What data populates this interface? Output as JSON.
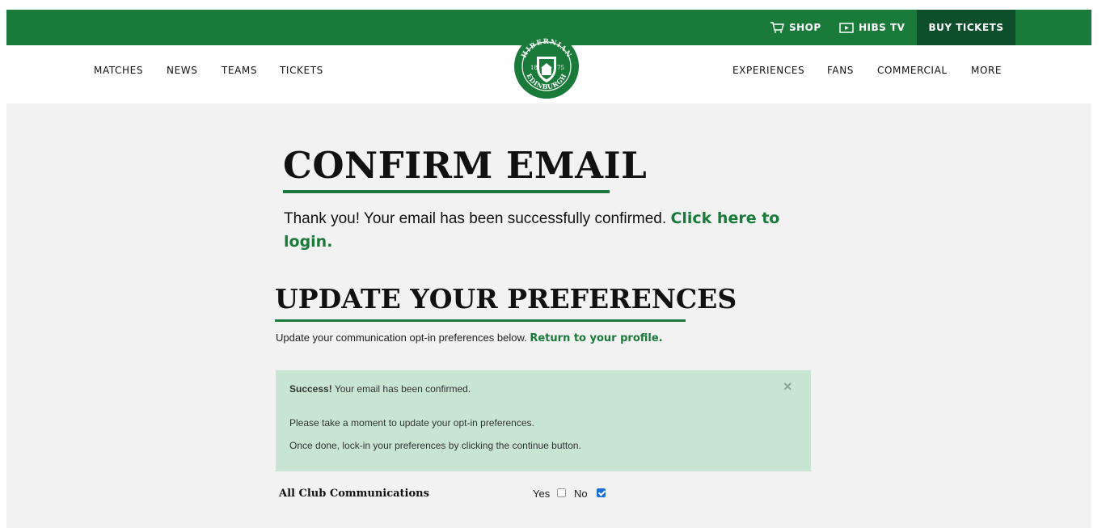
{
  "topbar": {
    "shop_label": "SHOP",
    "tv_label": "HIBS TV",
    "buy_label": "BUY TICKETS"
  },
  "nav": {
    "left": [
      "MATCHES",
      "NEWS",
      "TEAMS",
      "TICKETS"
    ],
    "right": [
      "EXPERIENCES",
      "FANS",
      "COMMERCIAL",
      "MORE"
    ]
  },
  "logo": {
    "top_text": "HIBERNIAN",
    "bottom_text": "EDINBURGH",
    "year_left": "18",
    "year_right": "75"
  },
  "confirm": {
    "heading": "CONFIRM EMAIL",
    "message": "Thank you! Your email has been successfully confirmed.",
    "login_link": "Click here to login."
  },
  "preferences": {
    "heading": "UPDATE YOUR PREFERENCES",
    "intro": "Update your communication opt-in preferences below.",
    "profile_link": "Return to your profile."
  },
  "alert": {
    "title": "Success!",
    "title_rest": "Your email has been confirmed.",
    "line2": "Please take a moment to update your opt-in preferences.",
    "line3": "Once done, lock-in your preferences by clicking the continue button.",
    "close": "×"
  },
  "options": {
    "row_label": "All Club Communications",
    "yes_label": "Yes",
    "no_label": "No",
    "yes_checked": false,
    "no_checked": true
  },
  "colors": {
    "brand_green": "#1a7a3a",
    "dark_green": "#0e4f2b",
    "alert_bg": "#c7e5d2"
  }
}
